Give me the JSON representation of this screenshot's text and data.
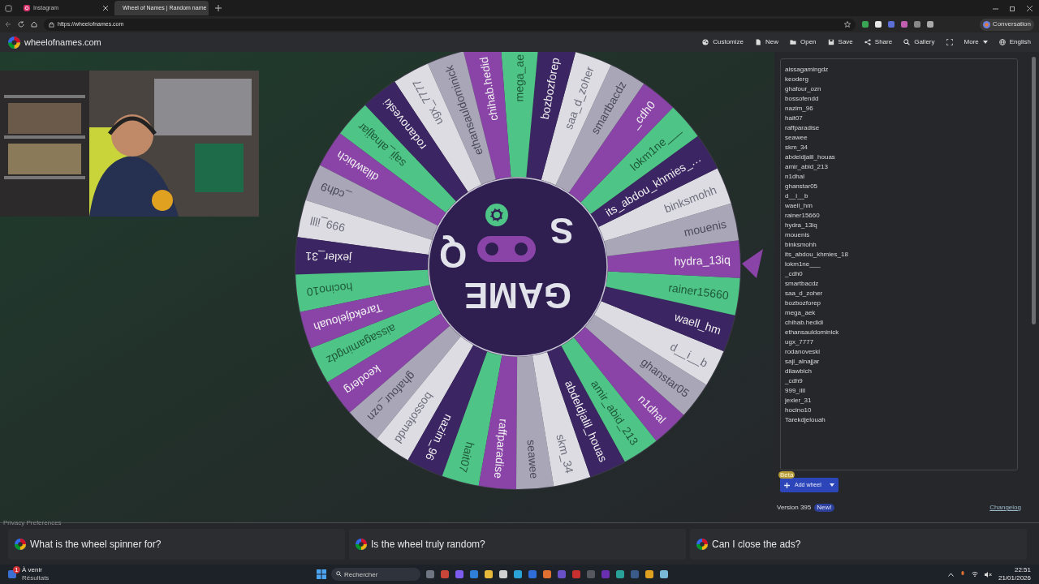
{
  "browser": {
    "tabs": [
      {
        "label": "Instagram",
        "selected": false
      },
      {
        "label": "Wheel of Names | Random name",
        "selected": true
      }
    ],
    "url": "https://wheelofnames.com",
    "profile_button": "Conversation"
  },
  "site": {
    "brand": "wheelofnames.com",
    "menu": [
      {
        "kind": "customize",
        "label": "Customize"
      },
      {
        "kind": "new",
        "label": "New"
      },
      {
        "kind": "open",
        "label": "Open"
      },
      {
        "kind": "save",
        "label": "Save"
      },
      {
        "kind": "share",
        "label": "Share"
      },
      {
        "kind": "gallery",
        "label": "Gallery"
      },
      {
        "kind": "fullscreen"
      },
      {
        "kind": "more",
        "label": "More"
      },
      {
        "kind": "language",
        "label": "English"
      }
    ]
  },
  "wheel": {
    "hub": {
      "word": "GAME",
      "letters": [
        "S",
        "Q"
      ]
    },
    "segments": [
      {
        "label": "aissagamingdz",
        "color": "#4fc487"
      },
      {
        "label": "keoderg",
        "color": "#8a44a8"
      },
      {
        "label": "ghafour_ozn",
        "color": "#a9a6b8"
      },
      {
        "label": "bossofendd",
        "color": "#dcdce2"
      },
      {
        "label": "nazim_96",
        "color": "#3b2563"
      },
      {
        "label": "hait07",
        "color": "#4fc487"
      },
      {
        "label": "raffparadise",
        "color": "#8a44a8"
      },
      {
        "label": "seawee",
        "color": "#a9a6b8"
      },
      {
        "label": "skm_34",
        "color": "#dcdce2"
      },
      {
        "label": "abdeldjalil_houas",
        "color": "#3b2563"
      },
      {
        "label": "amir_abid_213",
        "color": "#4fc487"
      },
      {
        "label": "n1dhal",
        "color": "#8a44a8"
      },
      {
        "label": "ghanstar05",
        "color": "#a9a6b8"
      },
      {
        "label": "d__i__b",
        "color": "#dcdce2"
      },
      {
        "label": "waell_hm",
        "color": "#3b2563"
      },
      {
        "label": "rainer15660",
        "color": "#4fc487"
      },
      {
        "label": "hydra_13iq",
        "color": "#8a44a8"
      },
      {
        "label": "mouenis",
        "color": "#a9a6b8"
      },
      {
        "label": "binksmohh",
        "color": "#dcdce2"
      },
      {
        "label": "its_abdou_khmies_…",
        "color": "#3b2563"
      },
      {
        "label": "lokm1ne___",
        "color": "#4fc487"
      },
      {
        "label": "_cdh0",
        "color": "#8a44a8"
      },
      {
        "label": "smartbacdz",
        "color": "#a9a6b8"
      },
      {
        "label": "saa_d_zoher",
        "color": "#dcdce2"
      },
      {
        "label": "bozbozforep",
        "color": "#3b2563"
      },
      {
        "label": "mega_ae",
        "color": "#4fc487"
      },
      {
        "label": "chihab.hedid",
        "color": "#8a44a8"
      },
      {
        "label": "ethansauldominick",
        "color": "#a9a6b8"
      },
      {
        "label": "ugx_7777",
        "color": "#dcdce2"
      },
      {
        "label": "rodanoveski",
        "color": "#3b2563"
      },
      {
        "label": "saji_alnajjar",
        "color": "#4fc487"
      },
      {
        "label": "dilawbich",
        "color": "#8a44a8"
      },
      {
        "label": "_cdh9",
        "color": "#a9a6b8"
      },
      {
        "label": "999_illl",
        "color": "#dcdce2"
      },
      {
        "label": "jexler_31",
        "color": "#3b2563"
      },
      {
        "label": "hocino10",
        "color": "#4fc487"
      },
      {
        "label": "Tarekdjelouah",
        "color": "#8a44a8"
      }
    ]
  },
  "entries": [
    "aissagamingdz",
    "keoderg",
    "ghafour_ozn",
    "bossofendd",
    "nazim_96",
    "hait07",
    "raffparadise",
    "seawee",
    "skm_34",
    "abdeldjalil_houas",
    "amir_abid_213",
    "n1dhal",
    "ghanstar05",
    "d__i__b",
    "waell_hm",
    "rainer15660",
    "hydra_13iq",
    "mouenis",
    "binksmohh",
    "its_abdou_khmies_18",
    "lokm1ne___",
    "_cdh0",
    "smartbacdz",
    "saa_d_zoher",
    "bozbozforep",
    "mega_aek",
    "chihab.hedidi",
    "ethansauldominick",
    "ugx_7777",
    "rodanoveski",
    "saji_alnajjar",
    "dilawbich",
    "_cdh9",
    "999_illl",
    "jexler_31",
    "hocino10",
    "Tarekdjelouah"
  ],
  "add_wheel": {
    "label": "Add wheel",
    "badge": "Beta"
  },
  "version": {
    "text": "Version 395",
    "badge": "New!",
    "link": "Changelog"
  },
  "privacy_link": "Privacy Preferences",
  "faq": [
    "What is the wheel spinner for?",
    "Is the wheel truly random?",
    "Can I close the ads?"
  ],
  "taskbar": {
    "widget": {
      "badge": "1",
      "title": "À venir",
      "subtitle": "Résultats"
    },
    "search_placeholder": "Rechercher",
    "time": "22:51",
    "date": "21/01/2026"
  }
}
